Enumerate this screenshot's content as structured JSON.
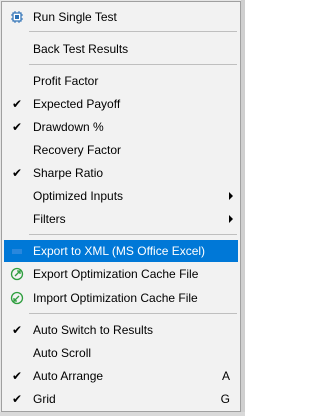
{
  "menu": {
    "run_single_test": {
      "label": "Run Single Test",
      "icon": "chip-icon"
    },
    "back_test_results": {
      "label": "Back Test Results"
    },
    "profit_factor": {
      "label": "Profit Factor",
      "checked": false
    },
    "expected_payoff": {
      "label": "Expected Payoff",
      "checked": true
    },
    "drawdown_percent": {
      "label": "Drawdown %",
      "checked": true
    },
    "recovery_factor": {
      "label": "Recovery Factor",
      "checked": false
    },
    "sharpe_ratio": {
      "label": "Sharpe Ratio",
      "checked": true
    },
    "optimized_inputs": {
      "label": "Optimized Inputs",
      "has_submenu": true
    },
    "filters": {
      "label": "Filters",
      "has_submenu": true
    },
    "export_xml": {
      "label": "Export to XML (MS Office Excel)",
      "highlighted": true,
      "icon": "xml-export-icon"
    },
    "export_cache": {
      "label": "Export Optimization Cache File",
      "icon": "green-export-icon"
    },
    "import_cache": {
      "label": "Import Optimization Cache File",
      "icon": "green-import-icon"
    },
    "auto_switch": {
      "label": "Auto Switch to Results",
      "checked": true
    },
    "auto_scroll": {
      "label": "Auto Scroll",
      "checked": false
    },
    "auto_arrange": {
      "label": "Auto Arrange",
      "checked": true,
      "shortcut": "A"
    },
    "grid": {
      "label": "Grid",
      "checked": true,
      "shortcut": "G"
    }
  },
  "colors": {
    "menu_bg": "#f2f2f2",
    "highlight": "#0078d7",
    "separator": "#bfbfbf",
    "green_icon": "#2e9e3e",
    "chip_icon": "#2a6fb5"
  }
}
